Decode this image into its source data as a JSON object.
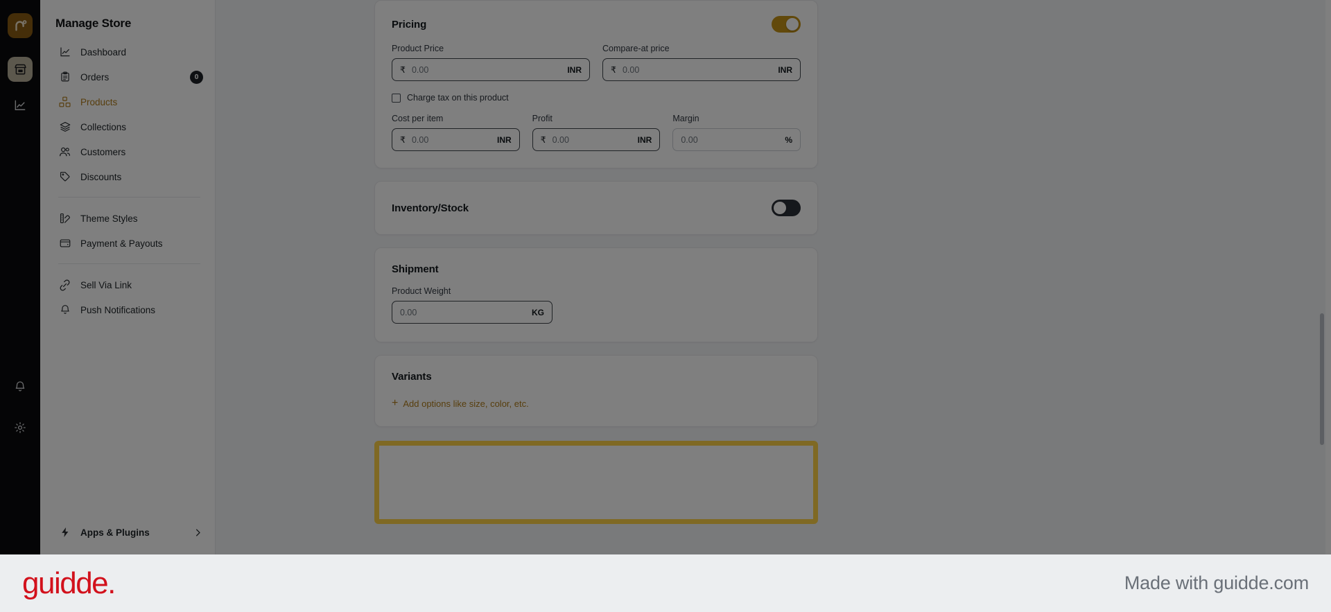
{
  "rail": {
    "logo_icon": "nexus-logo-icon",
    "items": [
      {
        "icon": "storefront-icon",
        "name": "store",
        "active": true
      },
      {
        "icon": "analytics-line-chart-icon",
        "name": "analytics",
        "active": false
      }
    ],
    "bottom_items": [
      {
        "icon": "bell-icon",
        "name": "notifications"
      },
      {
        "icon": "gear-icon",
        "name": "settings"
      }
    ]
  },
  "sidebar": {
    "title": "Manage Store",
    "items": [
      {
        "label": "Dashboard",
        "icon": "line-chart-icon",
        "active": false,
        "badge": null
      },
      {
        "label": "Orders",
        "icon": "clipboard-icon",
        "active": false,
        "badge": "0"
      },
      {
        "label": "Products",
        "icon": "boxes-icon",
        "active": true,
        "badge": null
      },
      {
        "label": "Collections",
        "icon": "layers-icon",
        "active": false,
        "badge": null
      },
      {
        "label": "Customers",
        "icon": "users-icon",
        "active": false,
        "badge": null
      },
      {
        "label": "Discounts",
        "icon": "tag-icon",
        "active": false,
        "badge": null
      },
      {
        "label": "Theme Styles",
        "icon": "palette-icon",
        "active": false,
        "badge": null
      },
      {
        "label": "Payment & Payouts",
        "icon": "wallet-icon",
        "active": false,
        "badge": null
      },
      {
        "label": "Sell Via Link",
        "icon": "link-icon",
        "active": false,
        "badge": null
      },
      {
        "label": "Push Notifications",
        "icon": "bell-icon",
        "active": false,
        "badge": null
      }
    ],
    "apps": {
      "label": "Apps & Plugins",
      "icon": "lightning-bolt-icon",
      "chevron": "chevron-right-icon"
    }
  },
  "pricing": {
    "title": "Pricing",
    "toggle_state": "on",
    "toggle_color": "#c59216",
    "product_price": {
      "label": "Product Price",
      "currency_symbol": "₹",
      "value": "0.00",
      "suffix": "INR"
    },
    "compare_at_price": {
      "label": "Compare-at price",
      "currency_symbol": "₹",
      "value": "0.00",
      "suffix": "INR"
    },
    "charge_tax": {
      "label": "Charge tax on this product",
      "checked": false
    },
    "cost_per_item": {
      "label": "Cost per item",
      "currency_symbol": "₹",
      "value": "0.00",
      "suffix": "INR"
    },
    "profit": {
      "label": "Profit",
      "currency_symbol": "₹",
      "value": "0.00",
      "suffix": "INR"
    },
    "margin": {
      "label": "Margin",
      "currency_symbol": "",
      "value": "0.00",
      "suffix": "%"
    }
  },
  "inventory": {
    "title": "Inventory/Stock",
    "toggle_state": "off",
    "toggle_color": "#2b3038"
  },
  "shipment": {
    "title": "Shipment",
    "product_weight": {
      "label": "Product Weight",
      "value": "0.00",
      "suffix": "KG"
    }
  },
  "variants": {
    "title": "Variants",
    "add_label": "Add options like size, color, etc.",
    "add_icon": "plus-icon",
    "accent_color": "#b07d1a"
  },
  "highlight": {
    "border_color": "#ffd349"
  },
  "branding": {
    "logo_text": "guidde.",
    "logo_color": "#d2111c",
    "made_with": "Made with guidde.com"
  }
}
